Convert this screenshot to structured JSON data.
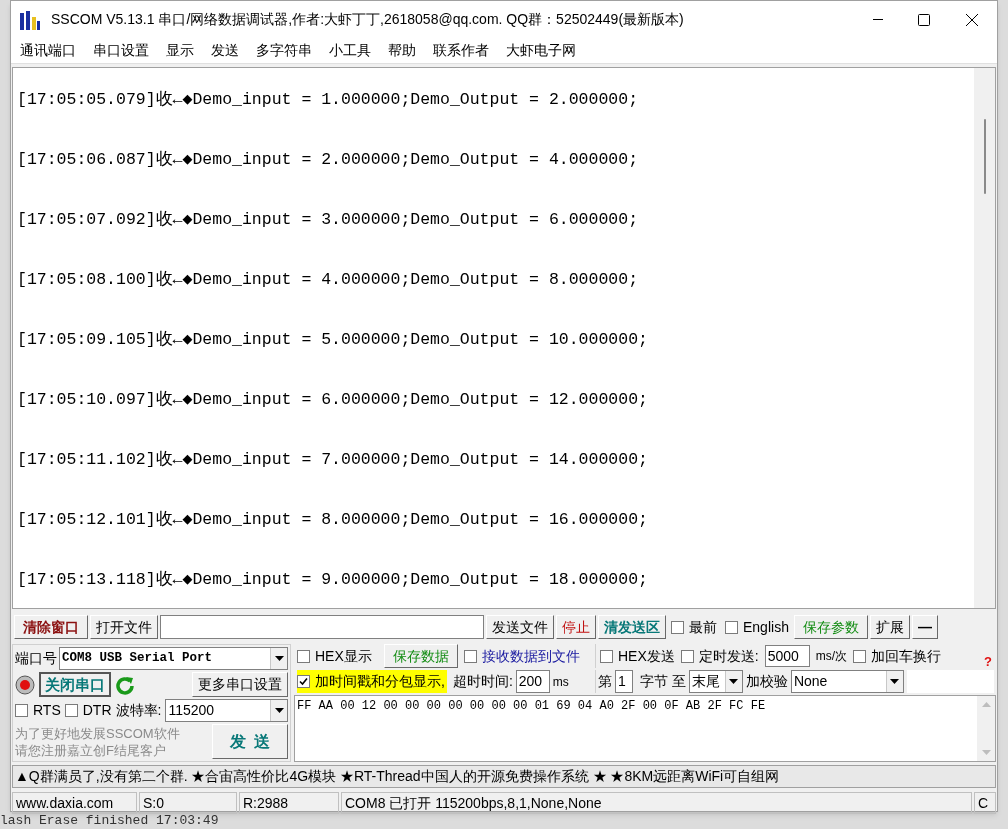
{
  "window": {
    "title": "SSCOM V5.13.1 串口/网络数据调试器,作者:大虾丁丁,2618058@qq.com. QQ群：52502449(最新版本)"
  },
  "menu": [
    "通讯端口",
    "串口设置",
    "显示",
    "发送",
    "多字符串",
    "小工具",
    "帮助",
    "联系作者",
    "大虾电子网"
  ],
  "log": [
    "[17:05:05.079]收←◆Demo_input = 1.000000;Demo_Output = 2.000000;",
    "[17:05:06.087]收←◆Demo_input = 2.000000;Demo_Output = 4.000000;",
    "[17:05:07.092]收←◆Demo_input = 3.000000;Demo_Output = 6.000000;",
    "[17:05:08.100]收←◆Demo_input = 4.000000;Demo_Output = 8.000000;",
    "[17:05:09.105]收←◆Demo_input = 5.000000;Demo_Output = 10.000000;",
    "[17:05:10.097]收←◆Demo_input = 6.000000;Demo_Output = 12.000000;",
    "[17:05:11.102]收←◆Demo_input = 7.000000;Demo_Output = 14.000000;",
    "[17:05:12.101]收←◆Demo_input = 8.000000;Demo_Output = 16.000000;",
    "[17:05:13.118]收←◆Demo_input = 9.000000;Demo_Output = 18.000000;"
  ],
  "toolbar": {
    "clear_window": "清除窗口",
    "open_file": "打开文件",
    "send_file": "发送文件",
    "stop": "停止",
    "clear_send": "清发送区",
    "checkboxes": [
      {
        "label": "最前",
        "checked": false
      },
      {
        "label": "English",
        "checked": false
      }
    ],
    "save_params": "保存参数",
    "expand": "扩展",
    "collapse": "—"
  },
  "port_panel": {
    "port_label": "端口号",
    "port": "COM8 USB Serial Port",
    "port_open": true,
    "close_port": "关闭串口",
    "more_settings": "更多串口设置",
    "rts": {
      "label": "RTS",
      "checked": false
    },
    "dtr": {
      "label": "DTR",
      "checked": false
    },
    "baud_label": "波特率:",
    "baud": "115200",
    "promo": [
      "为了更好地发展SSCOM软件",
      "请您注册嘉立创F结尾客户"
    ],
    "send": "发  送"
  },
  "receive_options": {
    "hex_display": {
      "label": "HEX显示",
      "checked": false
    },
    "save_data": "保存数据",
    "to_file": {
      "label": "接收数据到文件",
      "checked": false
    },
    "timestamp": {
      "label": "加时间戳和分包显示,",
      "checked": true
    },
    "timeout_label": "超时时间:",
    "timeout": "200",
    "timeout_unit": "ms"
  },
  "send_options": {
    "hex_send": {
      "label": "HEX发送",
      "checked": false
    },
    "timed_send": {
      "label": "定时发送:",
      "checked": false
    },
    "interval": "5000",
    "interval_unit": "ms/次",
    "add_crlf": {
      "label": "加回车换行",
      "checked": false
    },
    "help": "?",
    "from_label": "第",
    "from": "1",
    "to_label": "字节 至",
    "to": "末尾",
    "checksum_label": "加校验",
    "checksum": "None"
  },
  "send_text": "FF AA 00 12 00 00 00 00 00 00 00 01 69 04 A0 2F 00 0F AB 2F FC FE",
  "ad_bar": "▲Q群满员了,没有第二个群. ★合宙高性价比4G模块 ★RT-Thread中国人的开源免费操作系统 ★ ★8KM远距离WiFi可自组网",
  "status_bar": [
    "www.daxia.com",
    "S:0",
    "R:2988",
    "COM8 已打开  115200bps,8,1,None,None",
    "C"
  ],
  "background_text": "lash Erase finished 17:03:49"
}
